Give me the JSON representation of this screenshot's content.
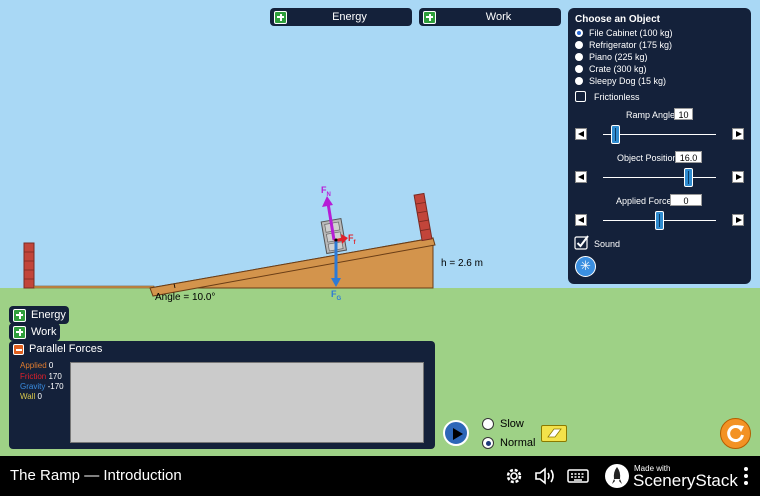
{
  "sim": {
    "title": "The Ramp — Introduction",
    "brand": {
      "made_with": "Made with",
      "name": "SceneryStack"
    }
  },
  "top_buttons": {
    "energy": "Energy",
    "work": "Work"
  },
  "scene": {
    "angle_label": "Angle = 10.0°",
    "height_label": "h = 2.6 m",
    "force_labels": {
      "normal": "F",
      "normal_sub": "N",
      "friction": "F",
      "friction_sub": "f",
      "gravity": "F",
      "gravity_sub": "G"
    },
    "colors": {
      "normal": "#b61dd6",
      "friction": "#e0202a",
      "gravity": "#2d7ad6",
      "ramp": "#d3944c",
      "ramp_edge": "#6a3d16",
      "wall": "#c2453a"
    }
  },
  "control_panel": {
    "title": "Choose an Object",
    "objects": [
      {
        "label": "File Cabinet (100 kg)",
        "selected": true
      },
      {
        "label": "Refrigerator (175 kg)",
        "selected": false
      },
      {
        "label": "Piano (225 kg)",
        "selected": false
      },
      {
        "label": "Crate (300 kg)",
        "selected": false
      },
      {
        "label": "Sleepy Dog (15 kg)",
        "selected": false
      }
    ],
    "frictionless": {
      "label": "Frictionless",
      "checked": false
    },
    "ramp_angle": {
      "label": "Ramp Angle",
      "value": "10"
    },
    "object_position": {
      "label": "Object Position",
      "value": "16.0"
    },
    "applied_force": {
      "label": "Applied Force",
      "value": "0"
    },
    "sound": {
      "label": "Sound",
      "checked": true
    }
  },
  "bottom_panels": {
    "energy": "Energy",
    "work": "Work",
    "parallel_forces": {
      "title": "Parallel Forces",
      "legend": [
        {
          "name": "Applied",
          "value": "0",
          "color": "#e07b2d"
        },
        {
          "name": "Friction",
          "value": "170",
          "color": "#e0202a"
        },
        {
          "name": "Gravity",
          "value": "-170",
          "color": "#3a8de0"
        },
        {
          "name": "Wall",
          "value": "0",
          "color": "#d9c84a"
        }
      ]
    }
  },
  "playback": {
    "slow": "Slow",
    "normal": "Normal",
    "selected": "normal"
  }
}
